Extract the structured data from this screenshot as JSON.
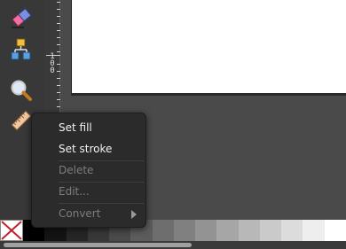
{
  "toolbox": {
    "tools": [
      {
        "name": "eraser-icon"
      },
      {
        "name": "connector-icon"
      },
      {
        "name": "zoom-icon"
      },
      {
        "name": "measure-icon"
      }
    ]
  },
  "ruler": {
    "label": "100",
    "digits": [
      "1",
      "0",
      "0"
    ]
  },
  "context_menu": {
    "items": [
      {
        "label": "Set fill",
        "enabled": true
      },
      {
        "label": "Set stroke",
        "enabled": true
      },
      {
        "label": "Delete",
        "enabled": false
      },
      {
        "label": "Edit...",
        "enabled": false
      },
      {
        "label": "Convert",
        "enabled": false,
        "submenu": true
      }
    ]
  },
  "palette": {
    "colors": [
      "#000000",
      "#141414",
      "#262626",
      "#383838",
      "#4a4a4a",
      "#5c5c5c",
      "#6e6e6e",
      "#808080",
      "#939393",
      "#a6a6a6",
      "#b8b8b8",
      "#cacaca",
      "#dcdcdc",
      "#eeeeee",
      "#ffffff"
    ]
  },
  "colors": {
    "menu_bg": "#2b2b2b",
    "canvas_page": "#ffffff",
    "workspace": "#4a4a4a"
  }
}
